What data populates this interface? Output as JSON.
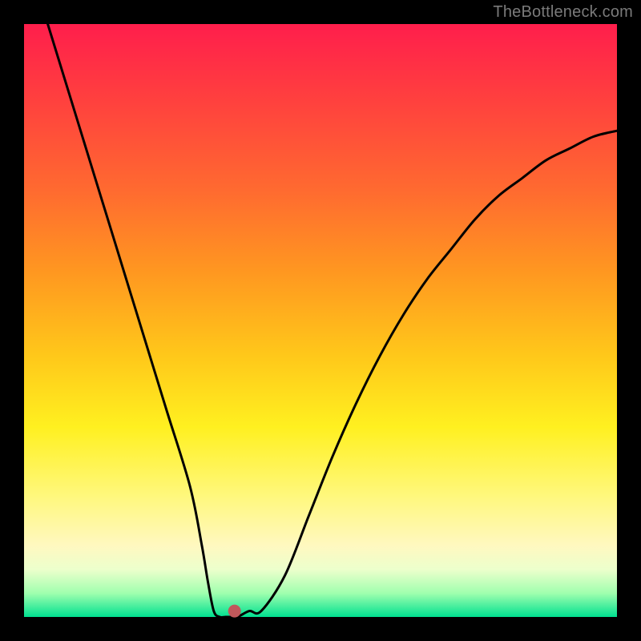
{
  "watermark": "TheBottleneck.com",
  "chart_data": {
    "type": "line",
    "title": "",
    "xlabel": "",
    "ylabel": "",
    "xlim": [
      0,
      100
    ],
    "ylim": [
      0,
      100
    ],
    "grid": false,
    "legend": false,
    "series": [
      {
        "name": "bottleneck-curve",
        "x": [
          4,
          8,
          12,
          16,
          20,
          24,
          28,
          30,
          31,
          32,
          33,
          34,
          35,
          36,
          38,
          40,
          44,
          48,
          52,
          56,
          60,
          64,
          68,
          72,
          76,
          80,
          84,
          88,
          92,
          96,
          100
        ],
        "y": [
          100,
          87,
          74,
          61,
          48,
          35,
          22,
          12,
          6,
          1,
          0,
          0,
          0,
          0,
          1,
          1,
          7,
          17,
          27,
          36,
          44,
          51,
          57,
          62,
          67,
          71,
          74,
          77,
          79,
          81,
          82
        ]
      }
    ],
    "marker": {
      "name": "optimal-point",
      "x": 35.5,
      "y": 1,
      "color": "#c1585b",
      "radius_px": 8
    },
    "colors": {
      "curve": "#000000",
      "background_top": "#ff1e4c",
      "background_bottom": "#00e090",
      "frame": "#000000"
    }
  }
}
